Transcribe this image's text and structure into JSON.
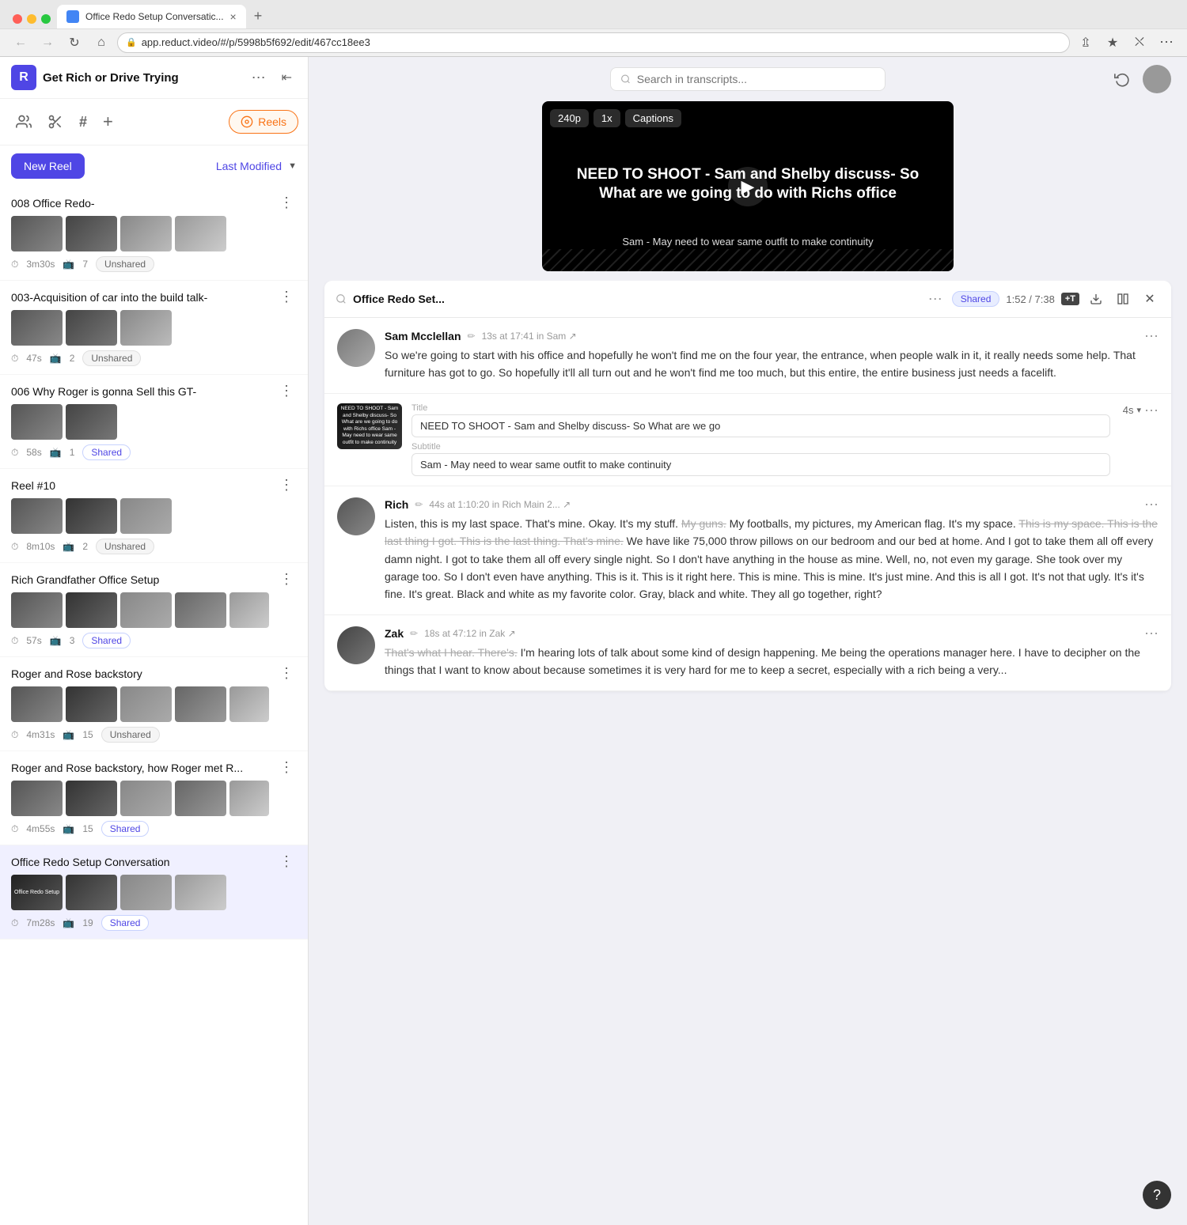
{
  "browser": {
    "tab_title": "Office Redo Setup Conversatic...",
    "url": "app.reduct.video/#/p/5998b5f692/edit/467cc18ee3",
    "new_tab_label": "+",
    "close_tab": "×"
  },
  "app": {
    "logo": "R",
    "title": "Get Rich or Drive Trying",
    "menu_icon": "⋯",
    "collapse_icon": "⇤"
  },
  "nav": {
    "people_icon": "👤",
    "clips_icon": "✂",
    "hash_icon": "#",
    "add_icon": "+",
    "reels_label": "Reels",
    "reels_icon": "⊙"
  },
  "sidebar": {
    "new_reel_label": "New Reel",
    "last_modified_label": "Last Modified",
    "sort_arrow": "▼"
  },
  "reels": [
    {
      "id": "reel-1",
      "title": "008 Office Redo-",
      "duration": "3m30s",
      "clips": "7",
      "status": "Unshared",
      "status_type": "unshared",
      "thumb_count": 4
    },
    {
      "id": "reel-2",
      "title": "003-Acquisition of car into the build talk-",
      "duration": "47s",
      "clips": "2",
      "status": "Unshared",
      "status_type": "unshared",
      "thumb_count": 3
    },
    {
      "id": "reel-3",
      "title": "006 Why Roger is gonna Sell this GT-",
      "duration": "58s",
      "clips": "1",
      "status": "Shared",
      "status_type": "shared",
      "thumb_count": 2
    },
    {
      "id": "reel-4",
      "title": "Reel #10",
      "duration": "8m10s",
      "clips": "2",
      "status": "Unshared",
      "status_type": "unshared",
      "thumb_count": 3
    },
    {
      "id": "reel-5",
      "title": "Rich Grandfather Office Setup",
      "duration": "57s",
      "clips": "3",
      "status": "Shared",
      "status_type": "shared",
      "thumb_count": 5
    },
    {
      "id": "reel-6",
      "title": "Roger and Rose backstory",
      "duration": "4m31s",
      "clips": "15",
      "status": "Unshared",
      "status_type": "unshared",
      "thumb_count": 5
    },
    {
      "id": "reel-7",
      "title": "Roger and Rose backstory, how Roger met R...",
      "duration": "4m55s",
      "clips": "15",
      "status": "Shared",
      "status_type": "shared",
      "thumb_count": 5
    },
    {
      "id": "reel-8",
      "title": "Office Redo Setup Conversation",
      "duration": "7m28s",
      "clips": "19",
      "status": "Shared",
      "status_type": "shared",
      "thumb_count": 4,
      "active": true
    }
  ],
  "search": {
    "placeholder": "Search in transcripts..."
  },
  "panel": {
    "title": "Office Redo Set...",
    "badge": "Shared",
    "time": "1:52 / 7:38",
    "menu": "⋯",
    "tt_label": "+T",
    "download_icon": "↓",
    "split_icon": "⎙",
    "close_icon": "✕"
  },
  "video": {
    "quality": "240p",
    "speed": "1x",
    "captions": "Captions",
    "title_text": "NEED TO SHOOT - Sam and Shelby discuss- So What are we going to do with Richs office",
    "subtitle_text": "Sam - May need to wear same outfit to make continuity"
  },
  "transcript_entries": [
    {
      "id": "entry-sam",
      "name": "Sam Mcclellan",
      "meta": "13s at 17:41 in Sam ↗",
      "text": "So we're going to start with his office and hopefully he won't find me on the four year, the entrance, when people walk in it, it really needs some help. That furniture has got to go. So hopefully it'll all turn out and he won't find me too much, but this entire, the entire business just needs a facelift.",
      "has_strikethrough": false
    },
    {
      "id": "entry-clip",
      "type": "clip",
      "thumb_title": "NEED TO SHOOT - Sam and Shelby discuss- So What are we going to do with Richs office Sam - May need to wear same outfit to make continuity",
      "title_label": "Title",
      "title_value": "NEED TO SHOOT - Sam and Shelby discuss- So What are we go",
      "subtitle_label": "Subtitle",
      "subtitle_value": "Sam - May need to wear same outfit to make continuity",
      "duration": "4s",
      "duration_arrow": "▾"
    },
    {
      "id": "entry-rich",
      "name": "Rich",
      "meta": "44s at 1:10:20 in Rich Main 2... ↗",
      "text_normal": "Listen, this is my last space. That's mine. Okay. It's my stuff. ",
      "text_strike1": "My guns.",
      "text_after1": " My footballs, my pictures, my American flag. It's my space. ",
      "text_strike2": "This is my space. This is the last thing I got. This is the last thing. That's mine.",
      "text_normal2": " We have like 75,000 throw pillows on our bedroom and our bed at home. And I got to take them all off every damn night. I got to take them all off every single night. So I don't have anything in the house as mine. Well, no, not even my garage. She took over my garage too. So I don't even have anything. This is it. This is it right here. This is mine. This is mine. It's just mine. And this is all I got. It's not that ugly. It's it's fine. It's great. Black and white as my favorite color. Gray, black and white. They all go together, right?",
      "has_strikethrough": true
    },
    {
      "id": "entry-zak",
      "name": "Zak",
      "meta": "18s at 47:12 in Zak ↗",
      "text_strike": "That's what I hear. There's.",
      "text_normal": " I'm hearing lots of talk about some kind of design happening. Me being the operations manager here. I have to decipher on the things that I want to know about because sometimes it is very hard for me to keep a secret, especially with a rich being a very..."
    }
  ],
  "help_label": "?"
}
